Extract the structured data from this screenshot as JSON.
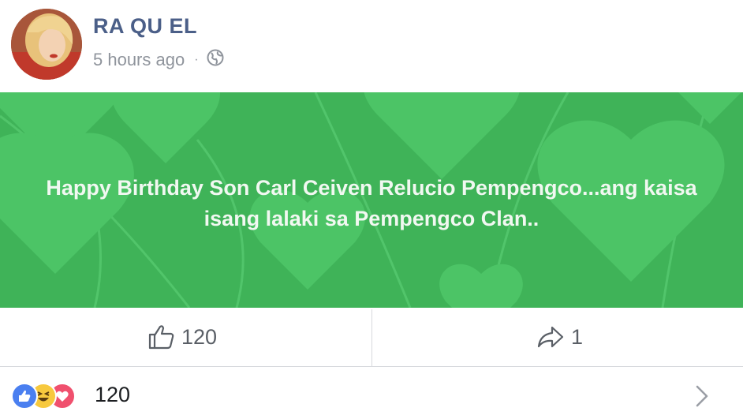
{
  "post": {
    "author_name": "RA QU EL",
    "timestamp": "5 hours ago",
    "separator": "·",
    "privacy_icon": "globe-icon",
    "message": "Happy Birthday Son Carl Ceiven Relucio Pempengco...ang kaisa isang lalaki sa Pempengco Clan.."
  },
  "actions": {
    "like_count": "120",
    "like_icon": "thumbs-up-icon",
    "share_count": "1",
    "share_icon": "share-arrow-icon"
  },
  "reactions": {
    "icons": [
      "like-icon",
      "haha-icon",
      "love-icon"
    ],
    "total": "120",
    "chevron_icon": "chevron-right-icon"
  },
  "colors": {
    "banner_background": "#3fb358",
    "banner_heart": "#4cc466",
    "author_name": "#4b5f88",
    "like_blue": "#4a7ff0",
    "love_red": "#f0506e",
    "haha_yellow": "#f7c93e"
  }
}
